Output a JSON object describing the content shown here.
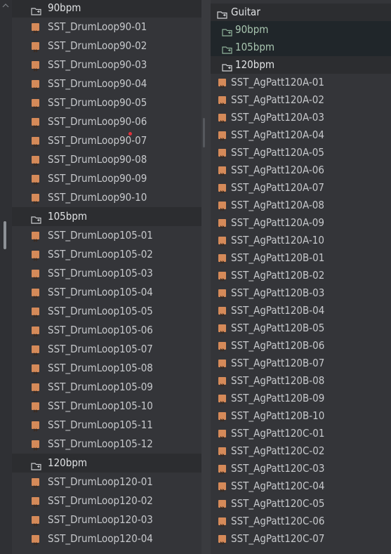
{
  "left": {
    "groups": [
      {
        "folder": "90bpm",
        "files": [
          "SST_DrumLoop90-01",
          "SST_DrumLoop90-02",
          "SST_DrumLoop90-03",
          "SST_DrumLoop90-04",
          "SST_DrumLoop90-05",
          "SST_DrumLoop90-06",
          "SST_DrumLoop90-07",
          "SST_DrumLoop90-08",
          "SST_DrumLoop90-09",
          "SST_DrumLoop90-10"
        ]
      },
      {
        "folder": "105bpm",
        "files": [
          "SST_DrumLoop105-01",
          "SST_DrumLoop105-02",
          "SST_DrumLoop105-03",
          "SST_DrumLoop105-04",
          "SST_DrumLoop105-05",
          "SST_DrumLoop105-06",
          "SST_DrumLoop105-07",
          "SST_DrumLoop105-08",
          "SST_DrumLoop105-09",
          "SST_DrumLoop105-10",
          "SST_DrumLoop105-11",
          "SST_DrumLoop105-12"
        ]
      },
      {
        "folder": "120bpm",
        "files": [
          "SST_DrumLoop120-01",
          "SST_DrumLoop120-02",
          "SST_DrumLoop120-03",
          "SST_DrumLoop120-04"
        ]
      }
    ]
  },
  "right": {
    "root": "Guitar",
    "subfolders": [
      "90bpm",
      "105bpm"
    ],
    "open_folder": "120bpm",
    "files": [
      "SST_AgPatt120A-01",
      "SST_AgPatt120A-02",
      "SST_AgPatt120A-03",
      "SST_AgPatt120A-04",
      "SST_AgPatt120A-05",
      "SST_AgPatt120A-06",
      "SST_AgPatt120A-07",
      "SST_AgPatt120A-08",
      "SST_AgPatt120A-09",
      "SST_AgPatt120A-10",
      "SST_AgPatt120B-01",
      "SST_AgPatt120B-02",
      "SST_AgPatt120B-03",
      "SST_AgPatt120B-04",
      "SST_AgPatt120B-05",
      "SST_AgPatt120B-06",
      "SST_AgPatt120B-07",
      "SST_AgPatt120B-08",
      "SST_AgPatt120B-09",
      "SST_AgPatt120B-10",
      "SST_AgPatt120C-01",
      "SST_AgPatt120C-02",
      "SST_AgPatt120C-03",
      "SST_AgPatt120C-04",
      "SST_AgPatt120C-05",
      "SST_AgPatt120C-06",
      "SST_AgPatt120C-07"
    ]
  },
  "icons": {
    "folder": "folder-open-icon",
    "file": "audio-file-icon"
  },
  "colors": {
    "background": "#343539",
    "folder_row": "#2c2d30",
    "sub_row": "#20262a",
    "file_icon": "#d58a59",
    "text": "#c6c8cb",
    "sub_text": "#a8c6b0",
    "marker": "#e0303a"
  }
}
